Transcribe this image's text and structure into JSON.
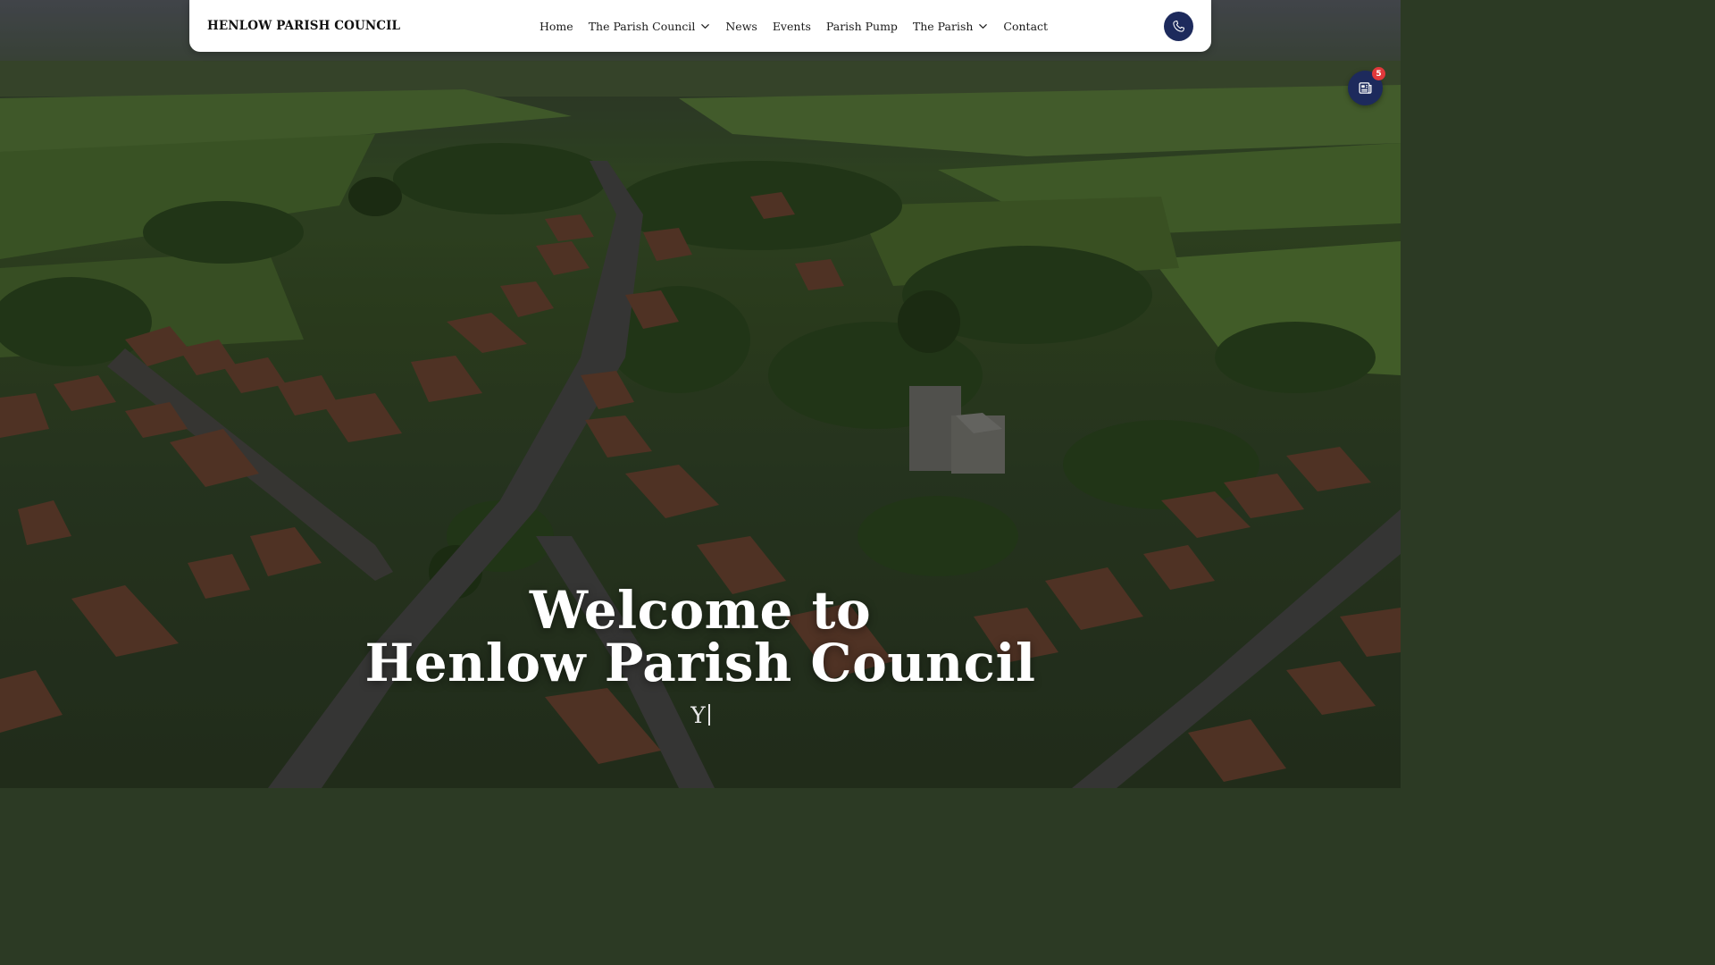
{
  "navbar": {
    "brand": "HENLOW PARISH COUNCIL",
    "links": [
      {
        "label": "Home",
        "has_dropdown": false
      },
      {
        "label": "The Parish Council",
        "has_dropdown": true
      },
      {
        "label": "News",
        "has_dropdown": false
      },
      {
        "label": "Events",
        "has_dropdown": false
      },
      {
        "label": "Parish Pump",
        "has_dropdown": false
      },
      {
        "label": "The Parish",
        "has_dropdown": true
      },
      {
        "label": "Contact",
        "has_dropdown": false
      }
    ],
    "phone_icon": "phone-icon"
  },
  "news_fab": {
    "icon": "newspaper-icon",
    "badge_count": "5"
  },
  "hero": {
    "title_line1": "Welcome to",
    "title_line2": "Henlow Parish Council",
    "subtitle_typed": "Y"
  },
  "colors": {
    "navy": "#1d2a5c",
    "badge_red": "#e0383b",
    "nav_bg": "#ffffff"
  }
}
